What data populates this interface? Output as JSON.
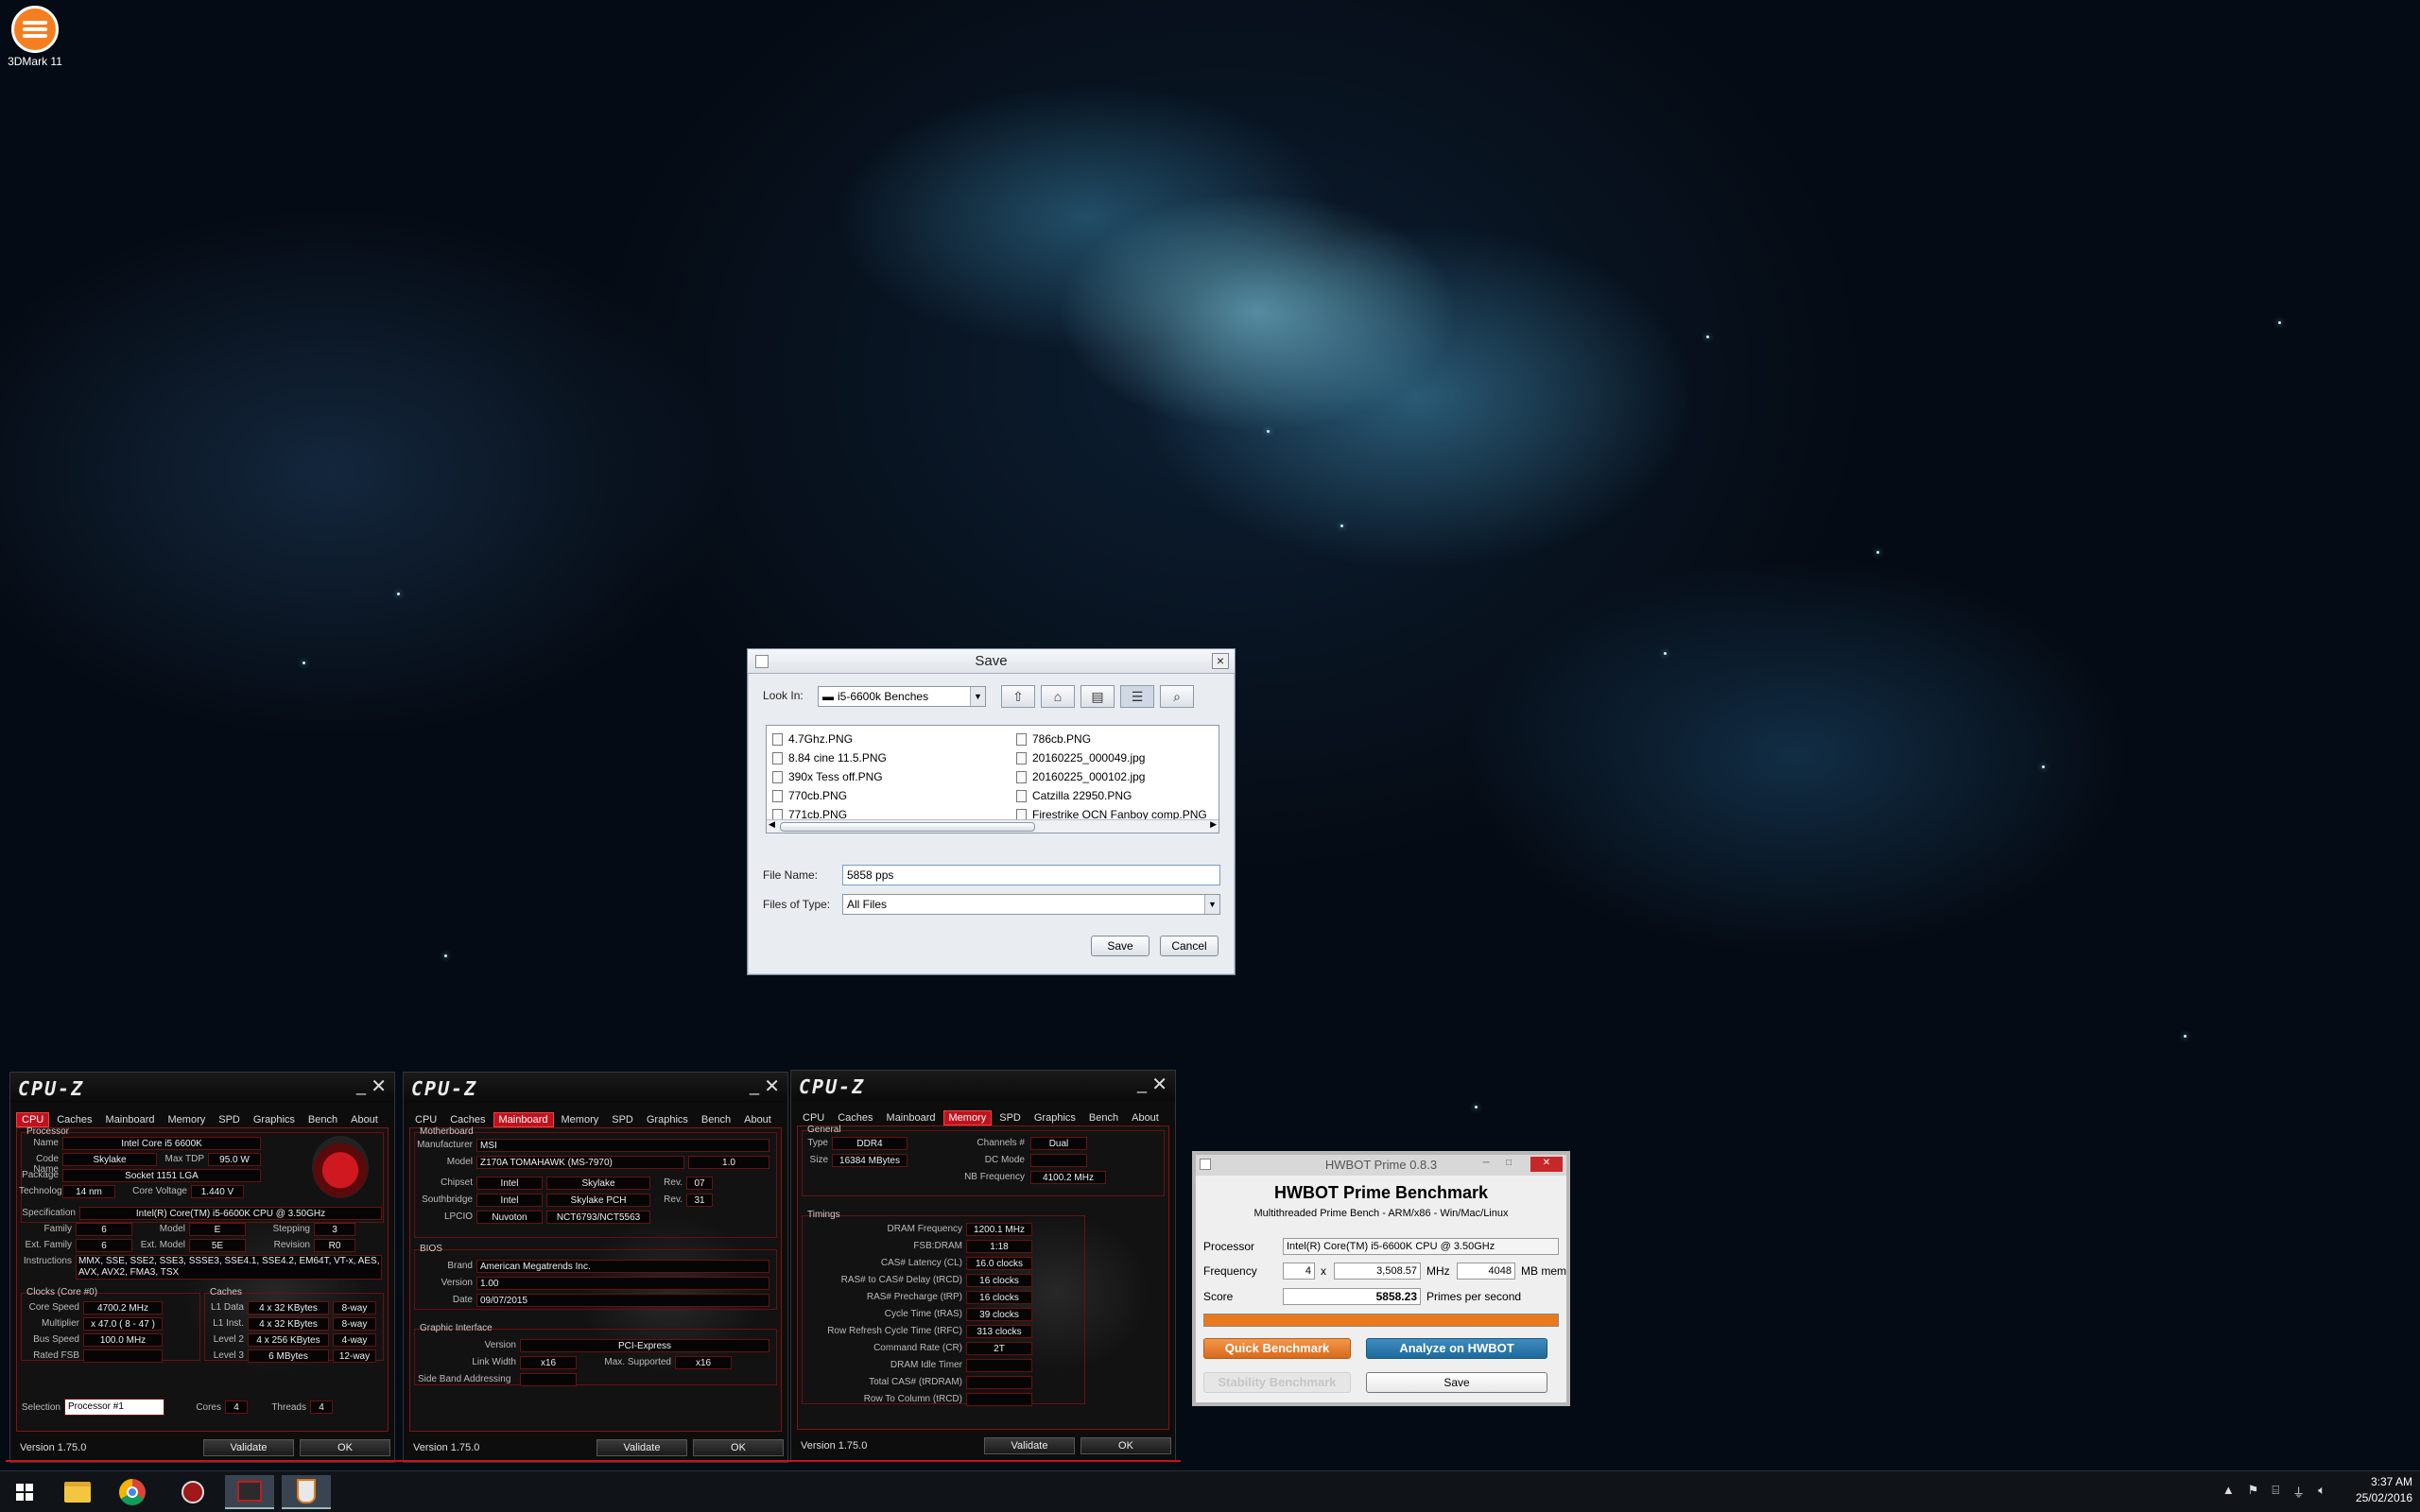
{
  "desktop": {
    "icon_label": "3DMark 11"
  },
  "save_dialog": {
    "title": "Save",
    "look_in_label": "Look In:",
    "look_in_value": "i5-6600k Benches",
    "files_col1": [
      "4.7Ghz.PNG",
      "8.84 cine 11.5.PNG",
      "390x Tess off.PNG",
      "770cb.PNG",
      "771cb.PNG"
    ],
    "files_col2": [
      "786cb.PNG",
      "20160225_000049.jpg",
      "20160225_000102.jpg",
      "Catzilla 22950.PNG",
      "Firestrike OCN Fanboy comp.PNG"
    ],
    "file_name_label": "File Name:",
    "file_name_value": "5858 pps",
    "file_type_label": "Files of Type:",
    "file_type_value": "All Files",
    "save_label": "Save",
    "cancel_label": "Cancel"
  },
  "cpuz_common": {
    "logo": "CPU-Z",
    "tabs": [
      "CPU",
      "Caches",
      "Mainboard",
      "Memory",
      "SPD",
      "Graphics",
      "Bench",
      "About"
    ],
    "version": "Version 1.75.0",
    "validate": "Validate",
    "ok": "OK"
  },
  "cpuz_cpu": {
    "processor_title": "Processor",
    "name_label": "Name",
    "name": "Intel Core i5 6600K",
    "code_name_label": "Code Name",
    "code_name": "Skylake",
    "max_tdp_label": "Max TDP",
    "max_tdp": "95.0 W",
    "package_label": "Package",
    "package": "Socket 1151 LGA",
    "technology_label": "Technology",
    "technology": "14 nm",
    "core_voltage_label": "Core Voltage",
    "core_voltage": "1.440 V",
    "specification_label": "Specification",
    "specification": "Intel(R) Core(TM) i5-6600K CPU @ 3.50GHz",
    "family_label": "Family",
    "family": "6",
    "model_label": "Model",
    "model": "E",
    "stepping_label": "Stepping",
    "stepping": "3",
    "ext_family_label": "Ext. Family",
    "ext_family": "6",
    "ext_model_label": "Ext. Model",
    "ext_model": "5E",
    "revision_label": "Revision",
    "revision": "R0",
    "instructions_label": "Instructions",
    "instructions": "MMX, SSE, SSE2, SSE3, SSSE3, SSE4.1, SSE4.2, EM64T, VT-x, AES, AVX, AVX2, FMA3, TSX",
    "clocks_title": "Clocks (Core #0)",
    "core_speed_label": "Core Speed",
    "core_speed": "4700.2 MHz",
    "multiplier_label": "Multiplier",
    "multiplier": "x 47.0 ( 8 - 47 )",
    "bus_speed_label": "Bus Speed",
    "bus_speed": "100.0 MHz",
    "rated_fsb_label": "Rated FSB",
    "rated_fsb": "",
    "caches_title": "Caches",
    "l1d_label": "L1 Data",
    "l1d": "4 x 32 KBytes",
    "l1d_way": "8-way",
    "l1i_label": "L1 Inst.",
    "l1i": "4 x 32 KBytes",
    "l1i_way": "8-way",
    "l2_label": "Level 2",
    "l2": "4 x 256 KBytes",
    "l2_way": "4-way",
    "l3_label": "Level 3",
    "l3": "6 MBytes",
    "l3_way": "12-way",
    "selection_label": "Selection",
    "selection": "Processor #1",
    "cores_label": "Cores",
    "cores": "4",
    "threads_label": "Threads",
    "threads": "4"
  },
  "cpuz_mb": {
    "motherboard_title": "Motherboard",
    "manufacturer_label": "Manufacturer",
    "manufacturer": "MSI",
    "model_label": "Model",
    "model": "Z170A TOMAHAWK (MS-7970)",
    "model_rev": "1.0",
    "chipset_label": "Chipset",
    "chipset_vendor": "Intel",
    "chipset": "Skylake",
    "chipset_rev_label": "Rev.",
    "chipset_rev": "07",
    "southbridge_label": "Southbridge",
    "sb_vendor": "Intel",
    "sb": "Skylake PCH",
    "sb_rev_label": "Rev.",
    "sb_rev": "31",
    "lpcio_label": "LPCIO",
    "lpcio_vendor": "Nuvoton",
    "lpcio": "NCT6793/NCT5563",
    "bios_title": "BIOS",
    "brand_label": "Brand",
    "brand": "American Megatrends Inc.",
    "version_label": "Version",
    "version": "1.00",
    "date_label": "Date",
    "date": "09/07/2015",
    "graphic_title": "Graphic Interface",
    "gi_version_label": "Version",
    "gi_version": "PCI-Express",
    "link_width_label": "Link Width",
    "link_width": "x16",
    "max_supported_label": "Max. Supported",
    "max_supported": "x16",
    "side_band_label": "Side Band Addressing"
  },
  "cpuz_mem": {
    "general_title": "General",
    "type_label": "Type",
    "type": "DDR4",
    "channels_label": "Channels #",
    "channels": "Dual",
    "size_label": "Size",
    "size": "16384 MBytes",
    "dc_mode_label": "DC Mode",
    "nb_freq_label": "NB Frequency",
    "nb_freq": "4100.2 MHz",
    "timings_title": "Timings",
    "timings": [
      {
        "label": "DRAM Frequency",
        "value": "1200.1 MHz"
      },
      {
        "label": "FSB:DRAM",
        "value": "1:18"
      },
      {
        "label": "CAS# Latency (CL)",
        "value": "16.0 clocks"
      },
      {
        "label": "RAS# to CAS# Delay (tRCD)",
        "value": "16 clocks"
      },
      {
        "label": "RAS# Precharge (tRP)",
        "value": "16 clocks"
      },
      {
        "label": "Cycle Time (tRAS)",
        "value": "39 clocks"
      },
      {
        "label": "Row Refresh Cycle Time (tRFC)",
        "value": "313 clocks"
      },
      {
        "label": "Command Rate (CR)",
        "value": "2T"
      },
      {
        "label": "DRAM Idle Timer",
        "value": ""
      },
      {
        "label": "Total CAS# (tRDRAM)",
        "value": ""
      },
      {
        "label": "Row To Column (tRCD)",
        "value": ""
      }
    ]
  },
  "hwbot": {
    "title": "HWBOT Prime 0.8.3",
    "heading": "HWBOT Prime Benchmark",
    "subtitle": "Multithreaded Prime Bench - ARM/x86 - Win/Mac/Linux",
    "processor_label": "Processor",
    "processor": "Intel(R) Core(TM) i5-6600K CPU @ 3.50GHz",
    "frequency_label": "Frequency",
    "cores": "4",
    "x_label": "x",
    "frequency": "3,508.57",
    "mhz_label": "MHz",
    "mem": "4048",
    "mem_label": "MB mem",
    "score_label": "Score",
    "score": "5858.23",
    "score_unit": "Primes per second",
    "progress": 1.0,
    "quick_label": "Quick Benchmark",
    "analyze_label": "Analyze on HWBOT",
    "stability_label": "Stability Benchmark",
    "save_label": "Save"
  },
  "taskbar": {
    "time": "3:37 AM",
    "date": "25/02/2016"
  }
}
